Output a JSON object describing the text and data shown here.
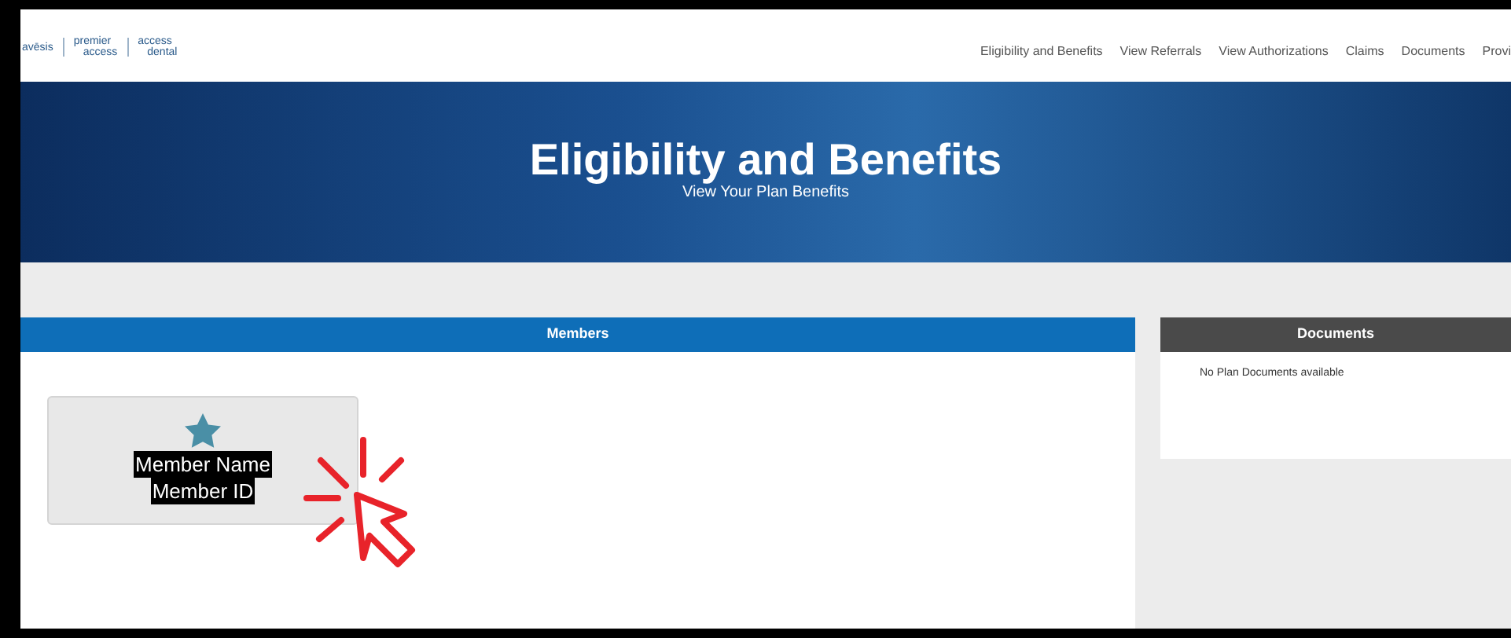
{
  "logos": [
    {
      "lines": [
        "avēsis"
      ]
    },
    {
      "lines": [
        "premier",
        "access"
      ]
    },
    {
      "lines": [
        "access",
        "dental"
      ]
    }
  ],
  "nav": [
    {
      "label": "Eligibility and Benefits"
    },
    {
      "label": "View Referrals"
    },
    {
      "label": "View Authorizations"
    },
    {
      "label": "Claims"
    },
    {
      "label": "Documents"
    },
    {
      "label": "Provi"
    }
  ],
  "banner": {
    "title": "Eligibility and Benefits",
    "subtitle": "View Your Plan Benefits"
  },
  "members": {
    "title": "Members",
    "cards": [
      {
        "name": "Member Name",
        "id": "Member ID"
      }
    ]
  },
  "documents": {
    "title": "Documents",
    "message": "No Plan Documents available"
  }
}
